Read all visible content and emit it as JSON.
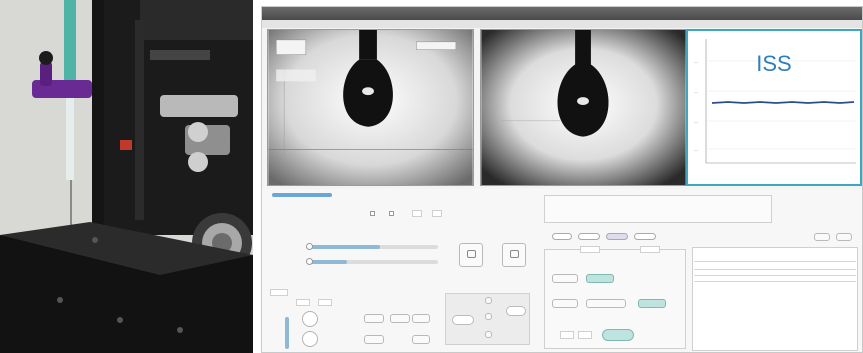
{
  "graph": {
    "overlay_label": "ISS"
  },
  "colors": {
    "graph_border": "#3fa6c2",
    "overlay_label": "#2d7fc0",
    "trend_line": "#2b4f8a",
    "clamp_purple": "#6a2a93",
    "syringe_teal": "#4fb3a6"
  },
  "icons": {
    "camera_1": "pendant-drop-image",
    "camera_2": "pendant-drop-image",
    "chart": "surface-tension-trend"
  }
}
